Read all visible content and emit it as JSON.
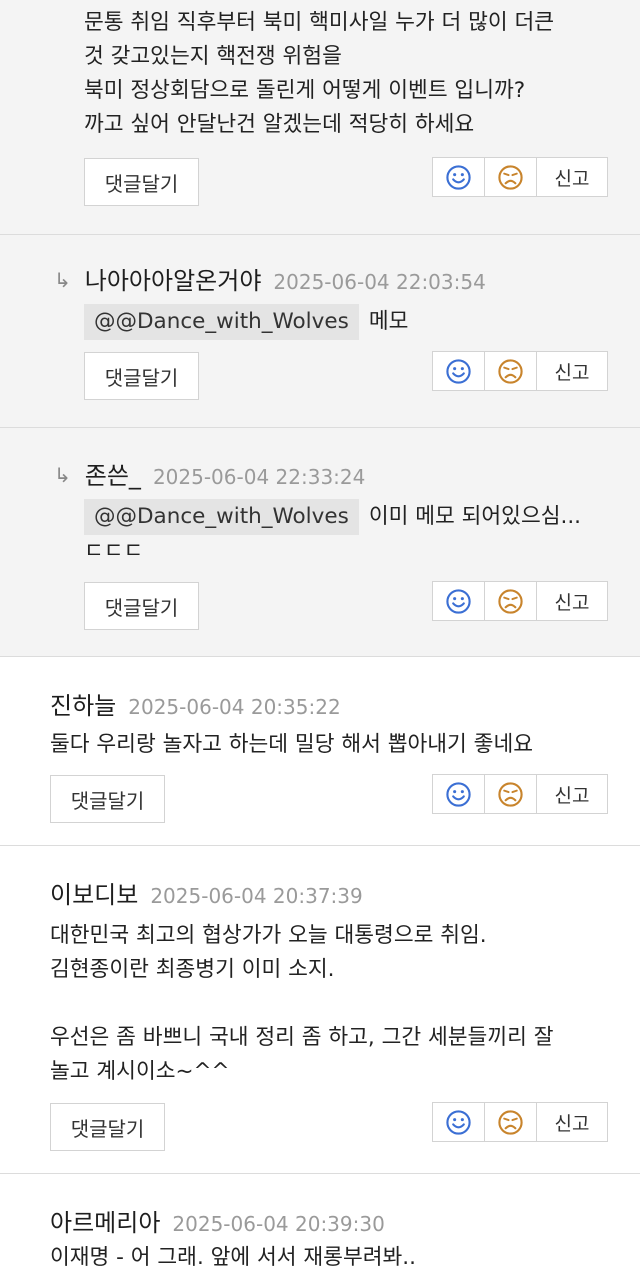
{
  "labels": {
    "reply_button": "댓글달기",
    "report": "신고",
    "reply_arrow": "↳"
  },
  "colors": {
    "like_icon": "#3b6fd4",
    "dislike_icon": "#c8842c"
  },
  "comments": [
    {
      "author": "",
      "date": "",
      "lines": [
        "문통 취임 직후부터 북미 핵미사일 누가 더 많이 더큰",
        "것 갖고있는지 핵전쟁 위험을",
        "북미 정상회담으로 돌린게 어떻게 이벤트 입니까?",
        "까고 싶어 안달난건 알겠는데 적당히 하세요"
      ]
    },
    {
      "author": "나아아아알온거야",
      "date": "2025-06-04 22:03:54",
      "mention": "@@Dance_with_Wolves",
      "lines": [
        "메모"
      ]
    },
    {
      "author": "존쓴_",
      "date": "2025-06-04 22:33:24",
      "mention": "@@Dance_with_Wolves",
      "lines": [
        "이미 메모 되어있으심...",
        "ㄷㄷㄷ"
      ]
    },
    {
      "author": "진하늘",
      "date": "2025-06-04 20:35:22",
      "lines": [
        "둘다 우리랑 놀자고 하는데 밀당 해서 뽑아내기 좋네요"
      ]
    },
    {
      "author": "이보디보",
      "date": "2025-06-04 20:37:39",
      "lines": [
        "대한민국 최고의 협상가가 오늘 대통령으로 취임.",
        "김현종이란 최종병기 이미 소지.",
        "",
        "우선은 좀 바쁘니 국내 정리 좀 하고, 그간 세분들끼리 잘",
        "놀고 계시이소~^^"
      ]
    },
    {
      "author": "아르메리아",
      "date": "2025-06-04 20:39:30",
      "lines": [
        "이재명 - 어 그래. 앞에 서서 재롱부려봐.."
      ]
    }
  ]
}
